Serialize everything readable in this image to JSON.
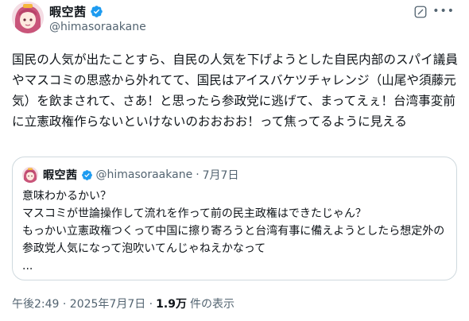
{
  "author": {
    "display_name": "暇空茜",
    "handle": "@himasoraakane"
  },
  "tweet": {
    "text": "国民の人気が出たことすら、自民の人気を下げようとした自民内部のスパイ議員やマスコミの思惑から外れてて、国民はアイスバケツチャレンジ（山尾や須藤元気）を飲まされて、さあ！と思ったら参政党に逃げて、まってえぇ！台湾事変前に立憲政権作らないといけないのおおおお！って焦ってるように見える"
  },
  "quote": {
    "display_name": "暇空茜",
    "handle": "@himasoraakane",
    "separator": "·",
    "date": "7月7日",
    "text": "意味わかるかい？\nマスコミが世論操作して流れを作って前の民主政権はできたじゃん？\nもっかい立憲政権つくって中国に擦り寄ろうと台湾有事に備えようとしたら想定外の参政党人気になって泡吹いてんじゃねえかなって\n..."
  },
  "footer": {
    "timestamp": "午後2:49 · 2025年7月7日 ·",
    "views": "1.9万",
    "views_label": "件の表示"
  },
  "colors": {
    "verified_blue": "#1d9bf0",
    "secondary_text": "#536471",
    "border": "#cfd9de"
  },
  "icons": [
    "verified-badge-icon",
    "grok-icon",
    "more-icon"
  ]
}
